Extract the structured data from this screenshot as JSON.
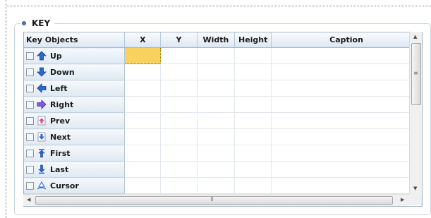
{
  "panel": {
    "title": "KEY"
  },
  "table": {
    "columns": [
      "Key Objects",
      "X",
      "Y",
      "Width",
      "Height",
      "Caption"
    ],
    "rows": [
      {
        "label": "Up",
        "icon": "up-arrow-icon",
        "checked": false
      },
      {
        "label": "Down",
        "icon": "down-arrow-icon",
        "checked": false
      },
      {
        "label": "Left",
        "icon": "left-arrow-icon",
        "checked": false
      },
      {
        "label": "Right",
        "icon": "right-arrow-icon",
        "checked": false
      },
      {
        "label": "Prev",
        "icon": "prev-page-icon",
        "checked": false
      },
      {
        "label": "Next",
        "icon": "next-page-icon",
        "checked": false
      },
      {
        "label": "First",
        "icon": "first-icon",
        "checked": false
      },
      {
        "label": "Last",
        "icon": "last-icon",
        "checked": false
      },
      {
        "label": "Cursor",
        "icon": "cursor-icon",
        "checked": false
      }
    ],
    "selected_cell": {
      "row": "Up",
      "column": "X"
    }
  },
  "colors": {
    "accent": "#3c6fb4",
    "selection": "#f9d15f",
    "header_gradient_end": "#dde7f1"
  }
}
